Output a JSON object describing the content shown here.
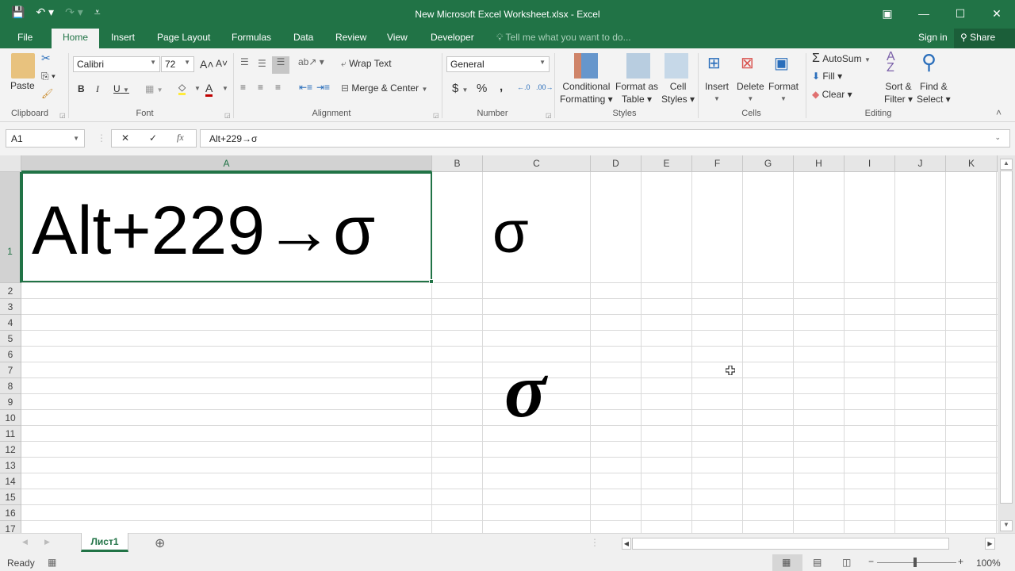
{
  "window": {
    "title": "New Microsoft Excel Worksheet.xlsx - Excel",
    "quick_access": {
      "save_icon": "save-icon",
      "undo_icon": "undo-icon",
      "redo_icon": "redo-icon",
      "customize_icon": "customize-qat-icon"
    },
    "controls": {
      "ribbon_display": "▣",
      "minimize": "—",
      "maximize": "☐",
      "close": "✕"
    }
  },
  "tabs": [
    {
      "label": "File"
    },
    {
      "label": "Home",
      "active": true
    },
    {
      "label": "Insert"
    },
    {
      "label": "Page Layout"
    },
    {
      "label": "Formulas"
    },
    {
      "label": "Data"
    },
    {
      "label": "Review"
    },
    {
      "label": "View"
    },
    {
      "label": "Developer"
    }
  ],
  "tell_me": "Tell me what you want to do...",
  "sign_in": "Sign in",
  "share": "Share",
  "ribbon": {
    "clipboard": {
      "label": "Clipboard",
      "paste": "Paste"
    },
    "font": {
      "label": "Font",
      "name": "Calibri",
      "size": "72",
      "bold": "B",
      "italic": "I",
      "underline": "U",
      "grow": "A˄",
      "shrink": "A˅"
    },
    "alignment": {
      "label": "Alignment",
      "wrap_text": "Wrap Text",
      "merge_center": "Merge & Center"
    },
    "number": {
      "label": "Number",
      "format": "General",
      "currency": "$",
      "percent": "%",
      "comma": ","
    },
    "styles": {
      "label": "Styles",
      "conditional": [
        "Conditional",
        "Formatting ▾"
      ],
      "format_table": [
        "Format as",
        "Table ▾"
      ],
      "cell_styles": [
        "Cell",
        "Styles ▾"
      ]
    },
    "cells": {
      "label": "Cells",
      "insert": "Insert",
      "delete": "Delete",
      "format": "Format"
    },
    "editing": {
      "label": "Editing",
      "autosum": "AutoSum",
      "fill": "Fill ▾",
      "clear": "Clear ▾",
      "sort_filter": [
        "Sort &",
        "Filter ▾"
      ],
      "find_select": [
        "Find &",
        "Select ▾"
      ]
    }
  },
  "formula_bar": {
    "name_box": "A1",
    "fx": "fx",
    "value": "Alt+229→σ"
  },
  "columns": [
    "A",
    "B",
    "C",
    "D",
    "E",
    "F",
    "G",
    "H",
    "I",
    "J",
    "K"
  ],
  "rows": [
    "1",
    "2",
    "3",
    "4",
    "5",
    "6",
    "7",
    "8",
    "9",
    "10",
    "11",
    "12",
    "13",
    "14",
    "15",
    "16",
    "17"
  ],
  "cells": {
    "A1": "Alt+229→σ",
    "C1": "σ",
    "C8": "σ"
  },
  "sheets": [
    {
      "label": "Лист1",
      "active": true
    }
  ],
  "status": {
    "ready": "Ready",
    "zoom": "100%"
  },
  "colors": {
    "accent": "#217346"
  }
}
